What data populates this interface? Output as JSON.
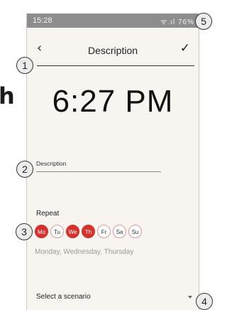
{
  "background": {
    "text": "h"
  },
  "status_bar": {
    "time": "15:28",
    "icons_text": "ᯤ.ıl 76%"
  },
  "header": {
    "back_icon": "chevron-left-icon",
    "back_glyph": "‹",
    "title": "Description",
    "confirm_glyph": "✓"
  },
  "time_display": "6:27 PM",
  "description": {
    "label": "Description",
    "value": ""
  },
  "repeat": {
    "label": "Repeat",
    "days": [
      {
        "label": "Mo",
        "selected": true
      },
      {
        "label": "Tu",
        "selected": false
      },
      {
        "label": "We",
        "selected": true
      },
      {
        "label": "Th",
        "selected": true
      },
      {
        "label": "Fr",
        "selected": false
      },
      {
        "label": "Sa",
        "selected": false
      },
      {
        "label": "Su",
        "selected": false
      }
    ],
    "summary": "Monday, Wednesday, Thursday"
  },
  "scenario": {
    "selected": "Select a scenario"
  },
  "callouts": [
    "1",
    "2",
    "3",
    "4",
    "5"
  ],
  "colors": {
    "accent": "#d7312c",
    "background": "#f8f4ef",
    "statusbar": "#8d8d8d"
  }
}
